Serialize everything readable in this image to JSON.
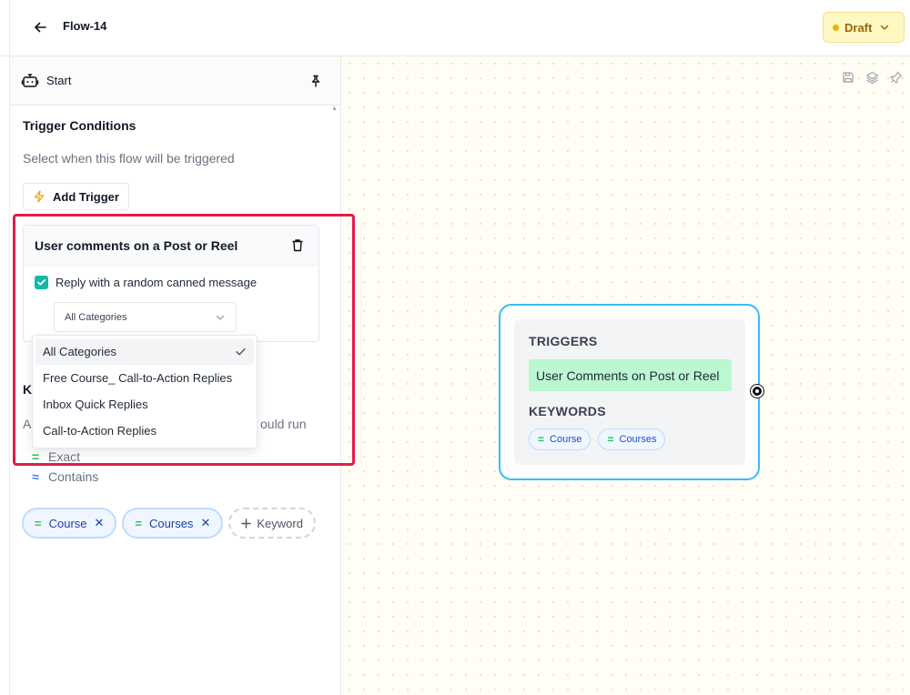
{
  "header": {
    "title": "Flow-14",
    "status_label": "Draft"
  },
  "panel": {
    "node_label": "Start",
    "trigger_conditions": {
      "title": "Trigger Conditions",
      "subtitle": "Select when this flow will be triggered",
      "add_trigger_label": "Add Trigger"
    },
    "trigger_card": {
      "title": "User comments on a Post or Reel",
      "checkbox_label": "Reply with a random canned message",
      "checkbox_checked": true,
      "select_value": "All Categories"
    },
    "dropdown": {
      "options": [
        {
          "label": "All Categories",
          "selected": true
        },
        {
          "label": "Free Course_ Call-to-Action Replies",
          "selected": false
        },
        {
          "label": "Inbox Quick Replies",
          "selected": false
        },
        {
          "label": "Call-to-Action Replies",
          "selected": false
        }
      ]
    },
    "keywords": {
      "title_visible": "K",
      "subtitle_left": "A",
      "subtitle_right": "ould run",
      "match_types": [
        {
          "symbol": "=",
          "label": "Exact"
        },
        {
          "symbol": "≈",
          "label": "Contains"
        }
      ],
      "chips": [
        {
          "label": "Course"
        },
        {
          "label": "Courses"
        }
      ],
      "add_label": "Keyword"
    }
  },
  "canvas": {
    "node": {
      "triggers_heading": "TRIGGERS",
      "trigger_item": "User Comments on Post or Reel",
      "keywords_heading": "KEYWORDS",
      "keyword_chips": [
        "Course",
        "Courses"
      ]
    }
  },
  "colors": {
    "accent_teal": "#14b8a6",
    "draft_bg": "#fef9c3",
    "highlight_red": "#e11d48",
    "node_border": "#38bdf8",
    "trigger_green": "#bbf7d0"
  }
}
